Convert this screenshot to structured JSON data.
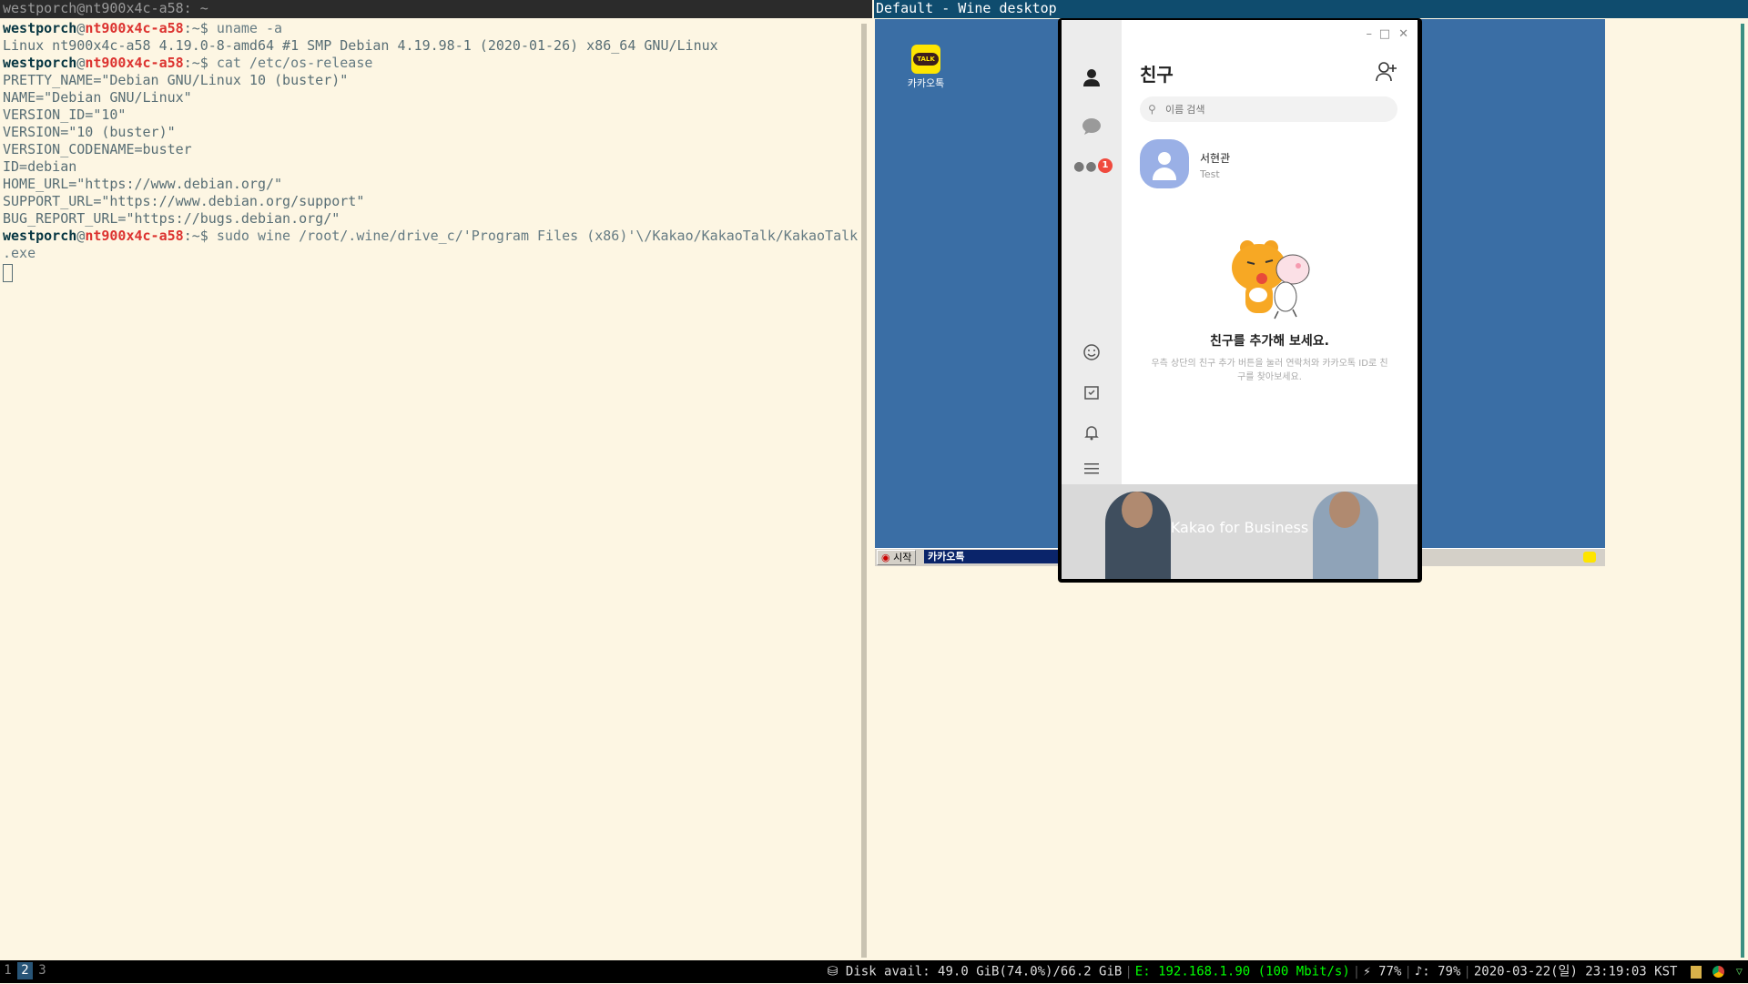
{
  "terminal": {
    "title": "westporch@nt900x4c-a58: ~",
    "prompt": {
      "user": "westporch",
      "at": "@",
      "host": "nt900x4c-a58",
      "suffix": ":~$ "
    },
    "cmd1": "uname -a",
    "out1": [
      "Linux nt900x4c-a58 4.19.0-8-amd64 #1 SMP Debian 4.19.98-1 (2020-01-26) x86_64 GNU/Linux"
    ],
    "cmd2": "cat /etc/os-release",
    "out2": [
      "PRETTY_NAME=\"Debian GNU/Linux 10 (buster)\"",
      "NAME=\"Debian GNU/Linux\"",
      "VERSION_ID=\"10\"",
      "VERSION=\"10 (buster)\"",
      "VERSION_CODENAME=buster",
      "ID=debian",
      "HOME_URL=\"https://www.debian.org/\"",
      "SUPPORT_URL=\"https://www.debian.org/support\"",
      "BUG_REPORT_URL=\"https://bugs.debian.org/\""
    ],
    "cmd3": "sudo wine /root/.wine/drive_c/'Program Files (x86)'\\/Kakao/KakaoTalk/KakaoTalk",
    "cmd3_wrap": ".exe"
  },
  "wine": {
    "title": "Default - Wine desktop",
    "desktop_icon": {
      "badge": "TALK",
      "label": "카카오톡"
    },
    "taskbar": {
      "start": "시작",
      "task": "카카오톡"
    }
  },
  "kakao": {
    "controls": {
      "minimize": "–",
      "maximize": "□",
      "close": "✕"
    },
    "title": "친구",
    "search": {
      "placeholder": "이름 검색",
      "value": ""
    },
    "notification_count": "1",
    "friend": {
      "name": "서현관",
      "status": "Test"
    },
    "empty": {
      "title": "친구를 추가해 보세요.",
      "desc": "우측 상단의 친구 추가 버튼을 눌러 연락처와 카카오톡 ID로 친구를 찾아보세요."
    },
    "banner": "Kakao for Business"
  },
  "bar": {
    "workspaces": [
      "1",
      "2",
      "3"
    ],
    "active_workspace": "2",
    "disk": "⛁ Disk avail: 49.0 GiB(74.0%)/66.2 GiB",
    "ethernet": "E: 192.168.1.90 (100 Mbit/s)",
    "battery": "⚡ 77%",
    "volume": "♪: 79%",
    "datetime": "2020-03-22(일) 23:19:03 KST"
  },
  "colors": {
    "terminal_bg": "#fdf6e3",
    "wine_desktop": "#3a6ea5",
    "kakao_yellow": "#fee500",
    "notification_red": "#f04a3e",
    "workspace_active": "#285577"
  }
}
